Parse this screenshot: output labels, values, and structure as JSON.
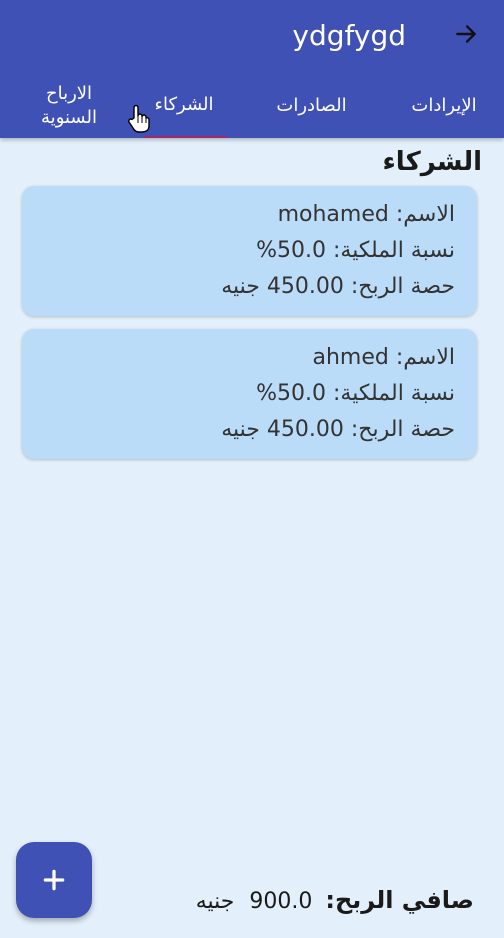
{
  "header": {
    "title": "ydgfygd",
    "back_icon": "arrow-right-icon"
  },
  "tabs": [
    {
      "label": "الإيرادات",
      "selected": false
    },
    {
      "label": "الصادرات",
      "selected": false
    },
    {
      "label": "الشركاء",
      "selected": true
    },
    {
      "label_line1": "الارباح",
      "label_line2": "السنوية",
      "selected": false
    }
  ],
  "section": {
    "title": "الشركاء"
  },
  "partners": [
    {
      "name_label": "الاسم:",
      "name": "mohamed",
      "share_label": "نسبة الملكية:",
      "share": "50.0%",
      "profit_label": "حصة الربح:",
      "profit": "450.00 جنيه"
    },
    {
      "name_label": "الاسم:",
      "name": "ahmed",
      "share_label": "نسبة الملكية:",
      "share": "50.0%",
      "profit_label": "حصة الربح:",
      "profit": "450.00 جنيه"
    }
  ],
  "footer": {
    "net_profit_label": "صافي الربح:",
    "net_profit_value": "900.0",
    "currency": "جنيه"
  },
  "fab": {
    "icon": "plus-icon"
  },
  "colors": {
    "appbar": "#3f51b5",
    "background": "#e3f0fb",
    "card": "#bbdcf8",
    "tab_indicator": "#9c2a6d"
  }
}
